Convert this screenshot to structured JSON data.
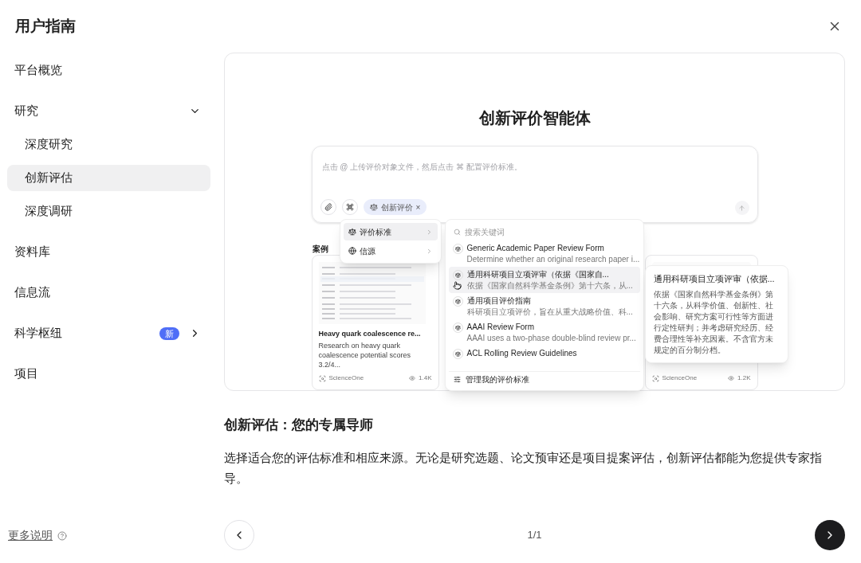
{
  "title": "用户指南",
  "sidebar": {
    "items": [
      {
        "label": "平台概览",
        "selected": false
      },
      {
        "label": "研究",
        "selected": false,
        "expanded": true,
        "children": [
          {
            "label": "深度研究",
            "selected": false
          },
          {
            "label": "创新评估",
            "selected": true
          },
          {
            "label": "深度调研",
            "selected": false
          }
        ]
      },
      {
        "label": "资料库",
        "selected": false
      },
      {
        "label": "信息流",
        "selected": false
      },
      {
        "label": "科学枢纽",
        "selected": false,
        "expanded": false,
        "badge": "新"
      },
      {
        "label": "项目",
        "selected": false
      }
    ],
    "footer_link": "更多说明"
  },
  "slide": {
    "preview": {
      "title": "创新评价智能体",
      "input": {
        "placeholder": "点击 @ 上传评价对象文件，然后点击 ⌘ 配置评价标准。",
        "chip": "创新评价",
        "chip_close": "×"
      },
      "menu": [
        {
          "label": "评价标准",
          "selected": true
        },
        {
          "label": "信源",
          "selected": false
        }
      ],
      "search": {
        "placeholder": "搜索关键词",
        "results": [
          {
            "title": "Generic Academic Paper Review Form",
            "desc": "Determine whether an original research paper i...",
            "selected": false
          },
          {
            "title": "通用科研项目立项评审（依据《国家自...",
            "desc": "依据《国家自然科学基金条例》第十六条，从...",
            "selected": true
          },
          {
            "title": "通用项目评价指南",
            "desc": "科研项目立项评价，旨在从重大战略价值、科...",
            "selected": false
          },
          {
            "title": "AAAI Review Form",
            "desc": "AAAI uses a two-phase double-blind review pr...",
            "selected": false
          },
          {
            "title": "ACL Rolling Review Guidelines",
            "selected": false
          }
        ],
        "footer": "管理我的评价标准"
      },
      "cases_label": "案例",
      "cases": [
        {
          "title": "Heavy quark coalescence re...",
          "desc": "Research on heavy quark coalescence potential scores 3.2/4...",
          "source": "ScienceOne",
          "views": "1.4K"
        },
        {
          "source": "ScienceOne",
          "views": "1.2K"
        }
      ],
      "tooltip": {
        "title": "通用科研项目立项评审（依据...",
        "body": "依据《国家自然科学基金条例》第十六条，从科学价值、创新性、社会影响、研究方案可行性等方面进行定性研判；并考虑研究经历、经费合理性等补充因素。不含官方未规定的百分制分档。"
      }
    },
    "heading": "创新评估：您的专属导师",
    "description": "选择适合您的评估标准和相应来源。无论是研究选题、论文预审还是项目提案评估，创新评估都能为您提供专家指导。"
  },
  "pager": {
    "page": "1/1"
  }
}
